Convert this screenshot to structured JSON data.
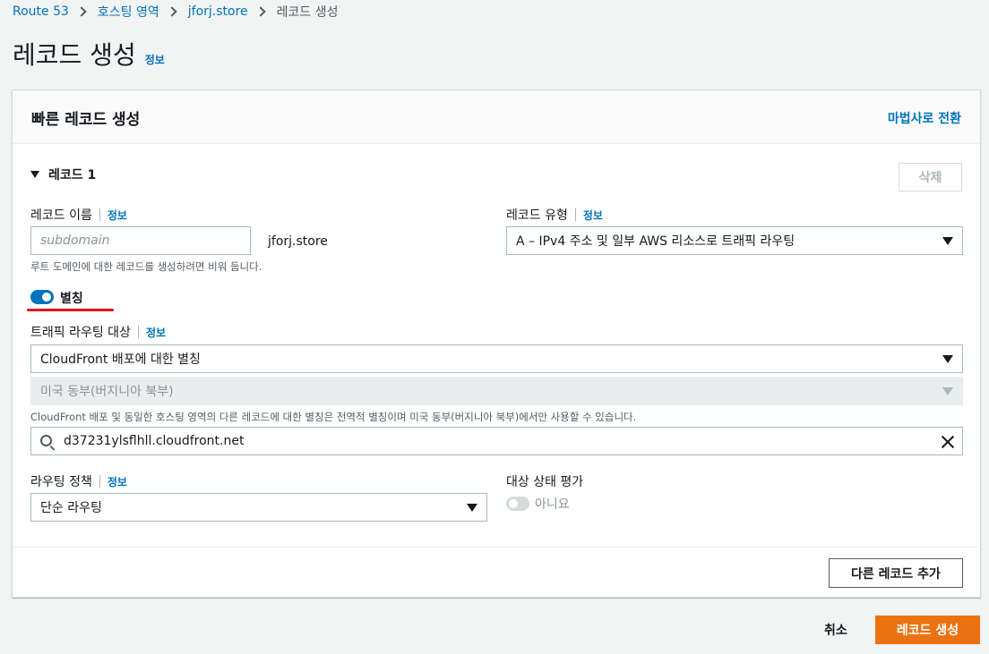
{
  "breadcrumb": {
    "items": [
      "Route 53",
      "호스팅 영역",
      "jforj.store",
      "레코드 생성"
    ]
  },
  "page": {
    "title": "레코드 생성",
    "info": "정보"
  },
  "panel": {
    "title": "빠른 레코드 생성",
    "wizard_link": "마법사로 전환",
    "record_header": "레코드 1",
    "delete_button": "삭제",
    "record_name": {
      "label": "레코드 이름",
      "info": "정보",
      "placeholder": "subdomain",
      "suffix": "jforj.store",
      "hint": "루트 도메인에 대한 레코드를 생성하려면 비워 둡니다."
    },
    "record_type": {
      "label": "레코드 유형",
      "info": "정보",
      "value": "A – IPv4 주소 및 일부 AWS 리소스로 트래픽 라우팅"
    },
    "alias": {
      "label": "별칭",
      "enabled": true
    },
    "route_target": {
      "label": "트래픽 라우팅 대상",
      "info": "정보",
      "endpoint": "CloudFront 배포에 대한 별칭",
      "region": "미국 동부(버지니아 북부)",
      "hint": "CloudFront 배포 및 동일한 호스팅 영역의 다른 레코드에 대한 별칭은 전역적 별칭이며 미국 동부(버지니아 북부)에서만 사용할 수 있습니다.",
      "search_value": "d37231ylsflhll.cloudfront.net"
    },
    "routing_policy": {
      "label": "라우팅 정책",
      "info": "정보",
      "value": "단순 라우팅"
    },
    "health_check": {
      "label": "대상 상태 평가",
      "value": "아니요",
      "enabled": false
    },
    "add_record_button": "다른 레코드 추가"
  },
  "footer": {
    "cancel": "취소",
    "create": "레코드 생성"
  },
  "colors": {
    "link": "#0073bb",
    "primary": "#ec7211",
    "toggle_on": "#0073bb",
    "highlight": "#e0141e"
  }
}
